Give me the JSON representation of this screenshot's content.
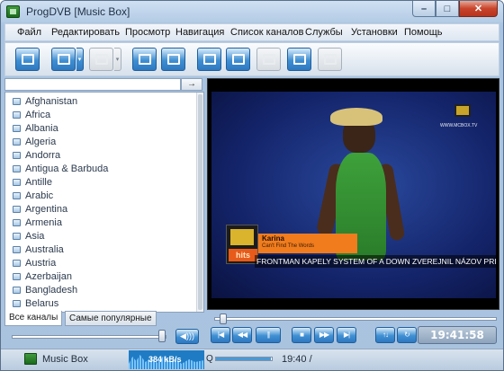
{
  "window": {
    "title": "ProgDVB [Music Box]"
  },
  "menu": [
    "Файл",
    "Редактировать",
    "Просмотр",
    "Навигация",
    "Список каналов",
    "Службы",
    "Установки",
    "Помощь"
  ],
  "channels": [
    "Afghanistan",
    "Africa",
    "Albania",
    "Algeria",
    "Andorra",
    "Antigua & Barbuda",
    "Antille",
    "Arabic",
    "Argentina",
    "Armenia",
    "Asia",
    "Australia",
    "Austria",
    "Azerbaijan",
    "Bangladesh",
    "Belarus"
  ],
  "search": {
    "go_label": "→"
  },
  "tabs": {
    "all_channels": "Все каналы",
    "most_popular": "Самые популярные"
  },
  "volume": {
    "level": 0.97
  },
  "playback": {
    "position": 0.02
  },
  "video": {
    "channel_url": "WWW.MCBOX.TV",
    "hits_label": "hits",
    "artist": "Karina",
    "song": "Can't Find The Words",
    "ticker": "FRONTMAN KAPELY SYSTEM OF A DOWN ZVEREJNIL NÁZOV PRIPRAVO"
  },
  "clock": "19:41:58",
  "status": {
    "channel": "Music Box",
    "bitrate": "384 kB/s",
    "quality_label": "Q",
    "quality_level": 0.98,
    "time": "19:40 /"
  },
  "colors": {
    "accent": "#2e78c0",
    "titlebar": "#b9d1ea"
  }
}
